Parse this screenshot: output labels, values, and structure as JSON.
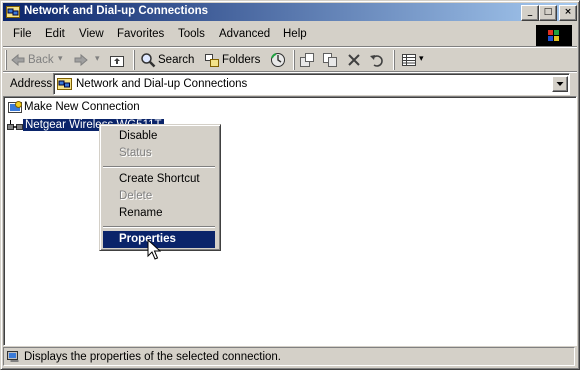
{
  "window": {
    "title": "Network and Dial-up Connections",
    "controls": {
      "minimize": "_",
      "maximize": "□",
      "close": "×"
    }
  },
  "menubar": {
    "items": [
      "File",
      "Edit",
      "View",
      "Favorites",
      "Tools",
      "Advanced",
      "Help"
    ]
  },
  "toolbar": {
    "back_label": "Back",
    "search_label": "Search",
    "folders_label": "Folders"
  },
  "address": {
    "label": "Address",
    "value": "Network and Dial-up Connections"
  },
  "content": {
    "items": [
      {
        "label": "Make New Connection",
        "icon": "new-connection-icon",
        "selected": false
      },
      {
        "label": "Netgear Wireless WG511T",
        "icon": "lan-connection-icon",
        "selected": true
      }
    ]
  },
  "context_menu": {
    "items": [
      {
        "label": "Disable",
        "enabled": true
      },
      {
        "label": "Status",
        "enabled": false
      },
      {
        "label": "Create Shortcut",
        "enabled": true
      },
      {
        "label": "Delete",
        "enabled": false
      },
      {
        "label": "Rename",
        "enabled": true
      },
      {
        "label": "Properties",
        "enabled": true,
        "highlighted": true,
        "default": true
      }
    ]
  },
  "statusbar": {
    "text": "Displays the properties of the selected connection."
  },
  "colors": {
    "title_start": "#0a246a",
    "title_end": "#a6caf0",
    "face": "#d4d0c8",
    "selection": "#0a246a"
  }
}
